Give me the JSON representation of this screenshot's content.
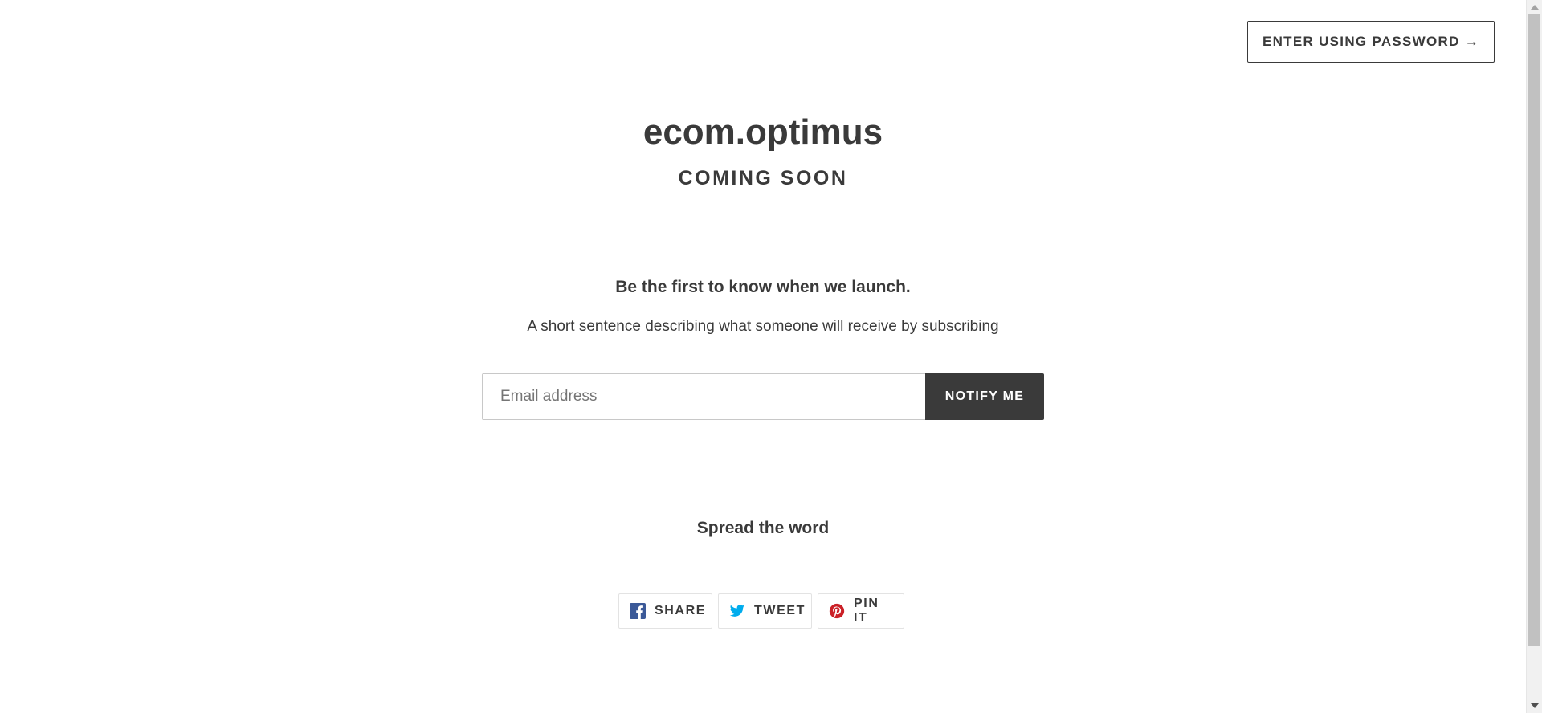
{
  "header": {
    "password_button_label": "ENTER USING PASSWORD →"
  },
  "hero": {
    "shop_name": "ecom.optimus",
    "coming_soon": "COMING SOON"
  },
  "signup": {
    "heading": "Be the first to know when we launch.",
    "text": "A short sentence describing what someone will receive by subscribing",
    "email_placeholder": "Email address",
    "email_value": "",
    "notify_label": "NOTIFY ME"
  },
  "share": {
    "heading": "Spread the word",
    "buttons": [
      {
        "label": "SHARE",
        "icon": "facebook-icon",
        "color": "#3b5998"
      },
      {
        "label": "TWEET",
        "icon": "twitter-icon",
        "color": "#00aced"
      },
      {
        "label": "PIN IT",
        "icon": "pinterest-icon",
        "color": "#cb2027"
      }
    ]
  },
  "colors": {
    "text": "#3a3a3a",
    "button_dark": "#3a3a3a",
    "background": "#ffffff"
  }
}
